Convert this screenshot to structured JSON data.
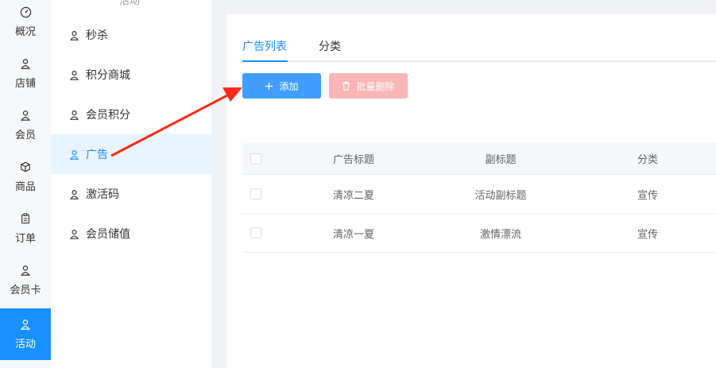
{
  "rail": {
    "items": [
      {
        "label": "概况",
        "icon": "dashboard-icon"
      },
      {
        "label": "店铺",
        "icon": "user-icon"
      },
      {
        "label": "会员",
        "icon": "user-icon"
      },
      {
        "label": "商品",
        "icon": "box-icon"
      },
      {
        "label": "订单",
        "icon": "clipboard-icon"
      },
      {
        "label": "会员卡",
        "icon": "user-icon"
      },
      {
        "label": "活动",
        "icon": "user-icon",
        "active": true
      }
    ]
  },
  "subnav": {
    "cut_label": "活动",
    "items": [
      {
        "label": "秒杀"
      },
      {
        "label": "积分商城"
      },
      {
        "label": "会员积分"
      },
      {
        "label": "广告",
        "active": true
      },
      {
        "label": "激活码"
      },
      {
        "label": "会员储值"
      }
    ]
  },
  "tabs": [
    {
      "label": "广告列表",
      "active": true
    },
    {
      "label": "分类"
    }
  ],
  "toolbar": {
    "add_label": "添加",
    "batch_delete_label": "批量删除"
  },
  "table": {
    "columns": [
      "广告标题",
      "副标题",
      "分类"
    ],
    "rows": [
      {
        "title": "清凉二夏",
        "subtitle": "活动副标题",
        "category": "宣传"
      },
      {
        "title": "清凉一夏",
        "subtitle": "激情漂流",
        "category": "宣传"
      }
    ]
  },
  "colors": {
    "accent": "#1890ff",
    "add_button": "#409eff",
    "delete_button_disabled": "#fab6b6",
    "annotation_arrow": "#ff2a1a"
  }
}
